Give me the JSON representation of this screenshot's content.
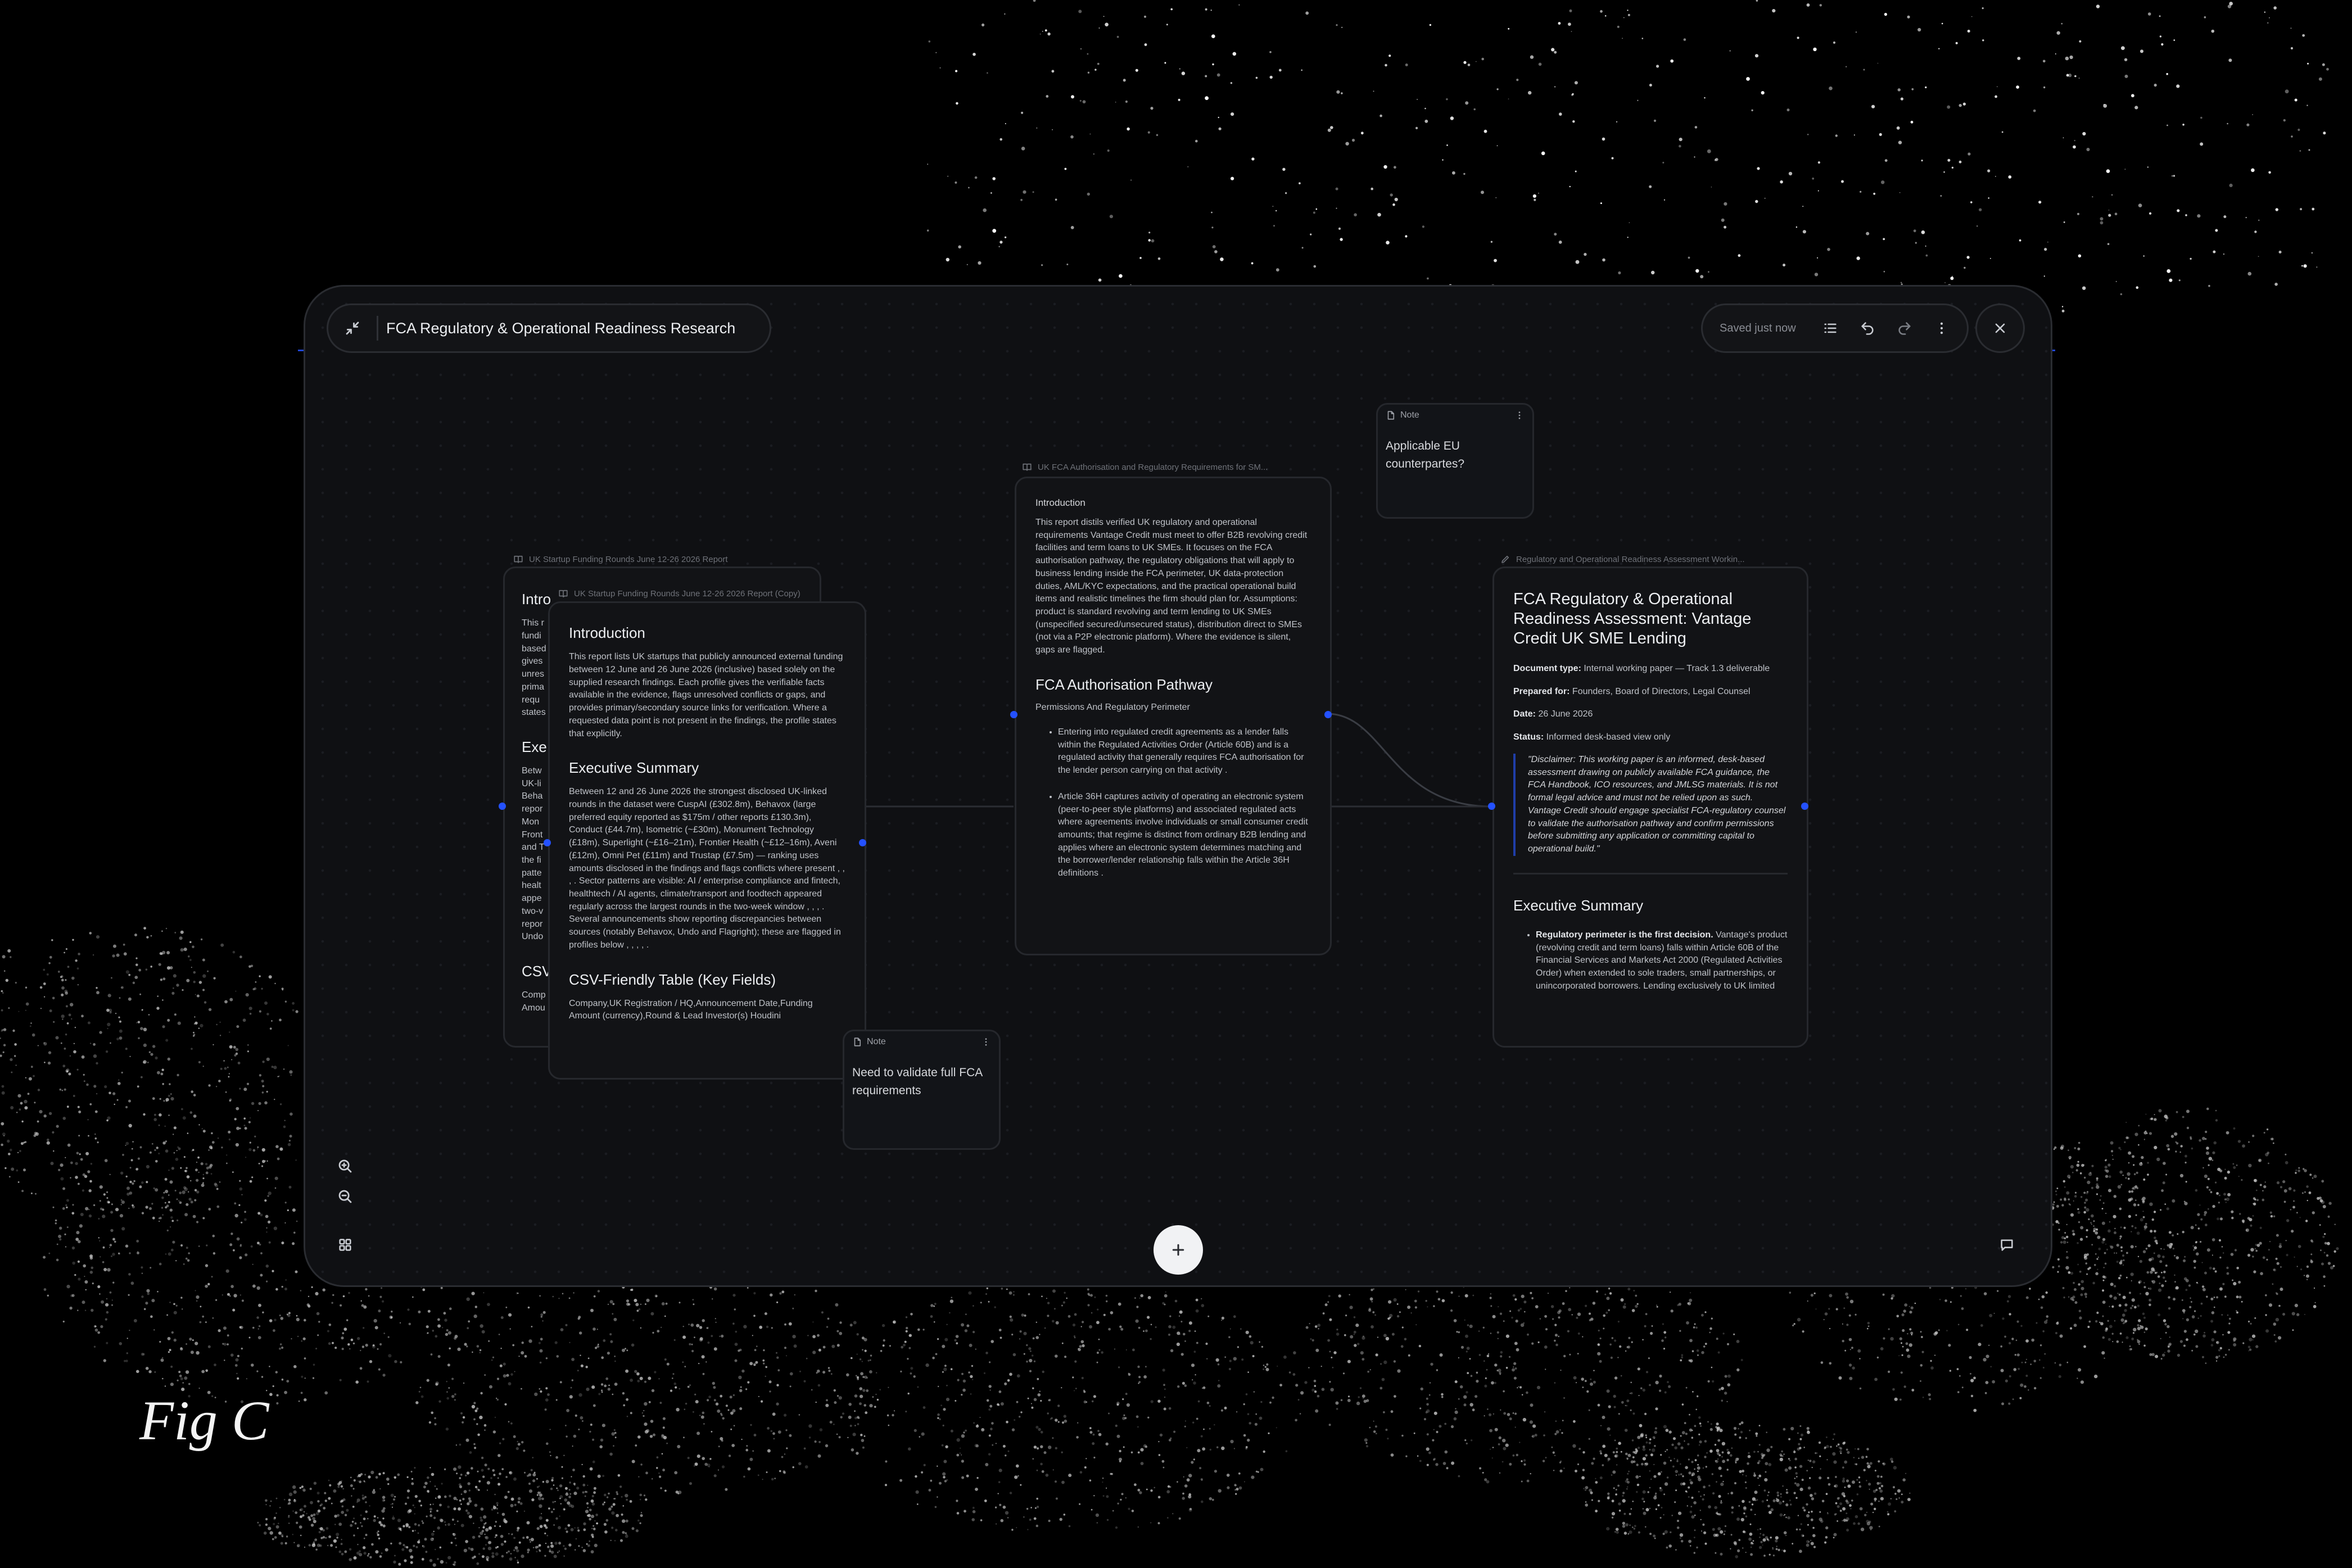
{
  "window": {
    "title": "FCA Regulatory & Operational Readiness Research"
  },
  "toolbar": {
    "saved_status": "Saved just now"
  },
  "cards": {
    "startup_original": {
      "header": "UK Startup Funding Rounds June 12-26 2026 Report",
      "intro_heading": "Intro",
      "intro_lines": [
        "This r",
        "fundi",
        "based",
        "gives",
        "unres",
        "prima",
        "requ",
        "states"
      ],
      "exec_heading": "Exe",
      "exec_lines": [
        "Betw",
        "UK-li",
        "Beha",
        "repor",
        "Mon",
        "Front",
        "and T",
        "the fi",
        "patte",
        "healt",
        "appe",
        "two-v",
        "repor",
        "Undo"
      ],
      "csv_heading": "CSV",
      "csv_lines": [
        " Comp",
        "Amou"
      ]
    },
    "startup_copy": {
      "header": "UK Startup Funding Rounds June 12-26 2026 Report (Copy)",
      "intro_heading": "Introduction",
      "intro_text": "This report lists UK startups that publicly announced external funding between 12 June and 26 June 2026 (inclusive) based solely on the supplied research findings. Each profile gives the verifiable facts available in the evidence, flags unresolved conflicts or gaps, and provides primary/secondary source links for verification. Where a requested data point is not present in the findings, the profile states that explicitly.",
      "exec_heading": "Executive Summary",
      "exec_text": "Between 12 and 26 June 2026 the strongest disclosed UK-linked rounds in the dataset were CuspAI (£302.8m), Behavox (large preferred equity reported as $175m / other reports £130.3m), Conduct (£44.7m), Isometric (~£30m), Monument Technology (£18m), Superlight (~£16–21m), Frontier Health (~£12–16m), Aveni (£12m), Omni Pet (£11m) and Trustap (£7.5m) — ranking uses amounts disclosed in the findings and flags conflicts where present , , , . Sector patterns are visible: AI / enterprise compliance and fintech, healthtech / AI agents, climate/transport and foodtech appeared regularly across the largest rounds in the two-week window , , , . Several announcements show reporting discrepancies between sources (notably Behavox, Undo and Flagright); these are flagged in profiles below , , , , .",
      "csv_heading": "CSV-Friendly Table (Key Fields)",
      "csv_text": " Company,UK Registration / HQ,Announcement Date,Funding Amount (currency),Round & Lead Investor(s) Houdini"
    },
    "fca": {
      "header": "UK FCA Authorisation and Regulatory Requirements for SM...",
      "intro_heading": "Introduction",
      "intro_text": "This report distils verified UK regulatory and operational requirements Vantage Credit must meet to offer B2B revolving credit facilities and term loans to UK SMEs. It focuses on the FCA authorisation pathway, the regulatory obligations that will apply to business lending inside the FCA perimeter, UK data-protection duties, AML/KYC expectations, and the practical operational build items and realistic timelines the firm should plan for. Assumptions: product is standard revolving and term lending to UK SMEs (unspecified secured/unsecured status), distribution direct to SMEs (not via a P2P electronic platform). Where the evidence is silent, gaps are flagged.",
      "pathway_heading": "FCA Authorisation Pathway",
      "pathway_sub": "Permissions And Regulatory Perimeter",
      "bullets": [
        "Entering into regulated credit agreements as a lender falls within the Regulated Activities Order (Article 60B) and is a regulated activity that generally requires FCA authorisation for the lender person carrying on that activity .",
        "Article 36H captures activity of operating an electronic system (peer-to-peer style platforms) and associated regulated acts where agreements involve individuals or small consumer credit amounts; that regime is distinct from ordinary B2B lending and applies where an electronic system determines matching and the borrower/lender relationship falls within the Article 36H definitions ."
      ]
    },
    "assessment": {
      "header": "Regulatory and Operational Readiness Assessment Workin...",
      "title": "FCA Regulatory & Operational Readiness Assessment: Vantage Credit UK SME Lending",
      "doc_type_label": "Document type:",
      "doc_type_value": " Internal working paper — Track 1.3 deliverable",
      "prepared_label": "Prepared for:",
      "prepared_value": " Founders, Board of Directors, Legal Counsel",
      "date_label": "Date:",
      "date_value": " 26 June 2026",
      "status_label": "Status:",
      "status_value": " Informed desk-based view only",
      "disclaimer": "\"Disclaimer: This working paper is an informed, desk-based assessment drawing on publicly available FCA guidance, the FCA Handbook, ICO resources, and JMLSG materials. It is not formal legal advice and must not be relied upon as such. Vantage Credit should engage specialist FCA-regulatory counsel to validate the authorisation pathway and confirm permissions before submitting any application or committing capital to operational build.\"",
      "exec_heading": "Executive Summary",
      "exec_bold": "Regulatory perimeter is the first decision.",
      "exec_text": " Vantage's product (revolving credit and term loans) falls within Article 60B of the Financial Services and Markets Act 2000 (Regulated Activities Order) when extended to sole traders, small partnerships, or unincorporated borrowers. Lending exclusively to UK limited"
    }
  },
  "notes": {
    "eu": {
      "label": "Note",
      "text": "Applicable EU counterpartes?"
    },
    "fca": {
      "label": "Note",
      "text": "Need to validate full FCA requirements"
    }
  },
  "figure_label": "Fig C",
  "icons": [
    "collapse-icon",
    "list-icon",
    "undo-icon",
    "redo-icon",
    "more-vertical-icon",
    "close-icon",
    "zoom-in-icon",
    "zoom-out-icon",
    "grid-icon",
    "plus-icon",
    "chat-icon",
    "book-icon",
    "note-icon",
    "pen-icon"
  ],
  "colors": {
    "background": "#000000",
    "canvas": "#0f1013",
    "card": "#121316",
    "accent_dot": "#2451ff",
    "border": "#2a2c31"
  }
}
